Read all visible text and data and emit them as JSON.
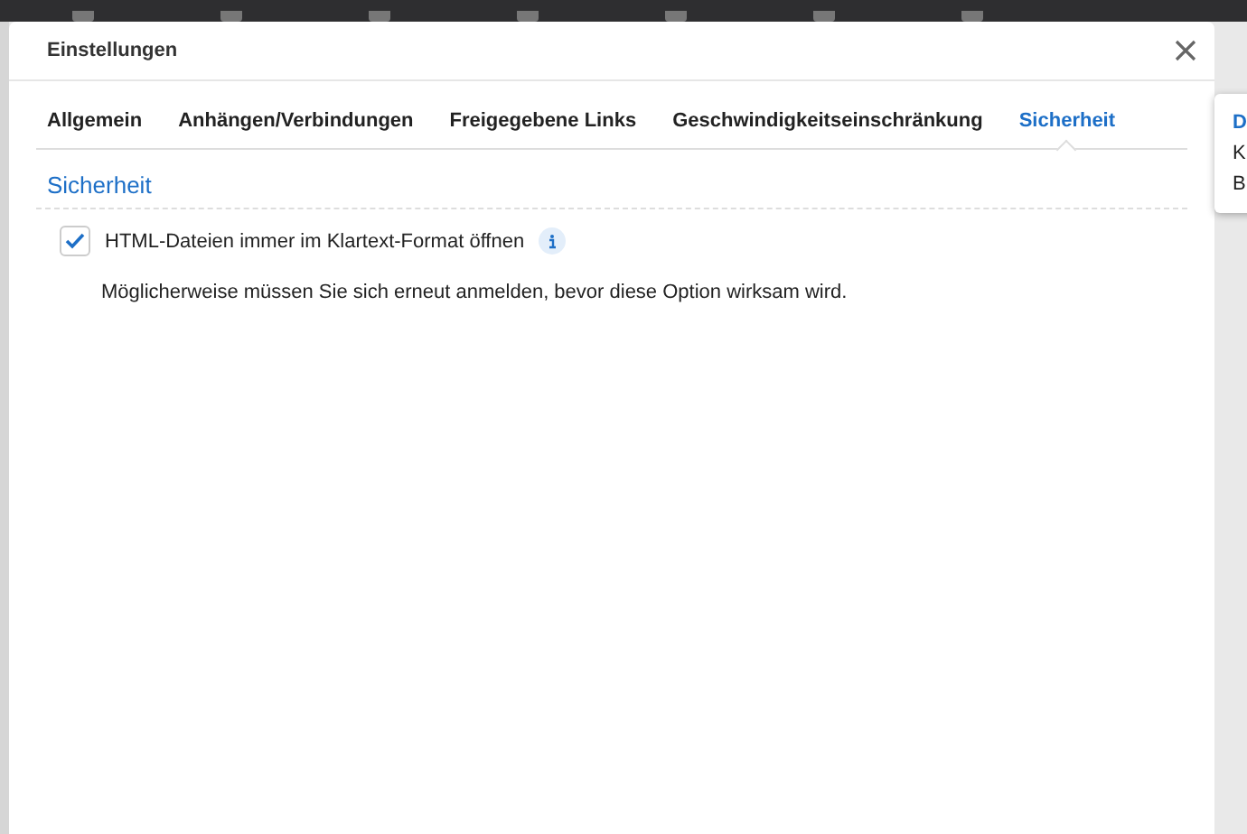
{
  "dialog": {
    "title": "Einstellungen"
  },
  "tabs": [
    {
      "label": "Allgemein",
      "selected": false
    },
    {
      "label": "Anhängen/Verbindungen",
      "selected": false
    },
    {
      "label": "Freigegebene Links",
      "selected": false
    },
    {
      "label": "Geschwindigkeitseinschränkung",
      "selected": false
    },
    {
      "label": "Sicherheit",
      "selected": true
    }
  ],
  "section": {
    "title": "Sicherheit",
    "option": {
      "label": "HTML-Dateien immer im Klartext-Format öffnen",
      "checked": true
    },
    "note": "Möglicherweise müssen Sie sich erneut anmelden, bevor diese Option wirksam wird."
  },
  "popover": {
    "title": "D",
    "lines": [
      "K",
      "B"
    ]
  }
}
